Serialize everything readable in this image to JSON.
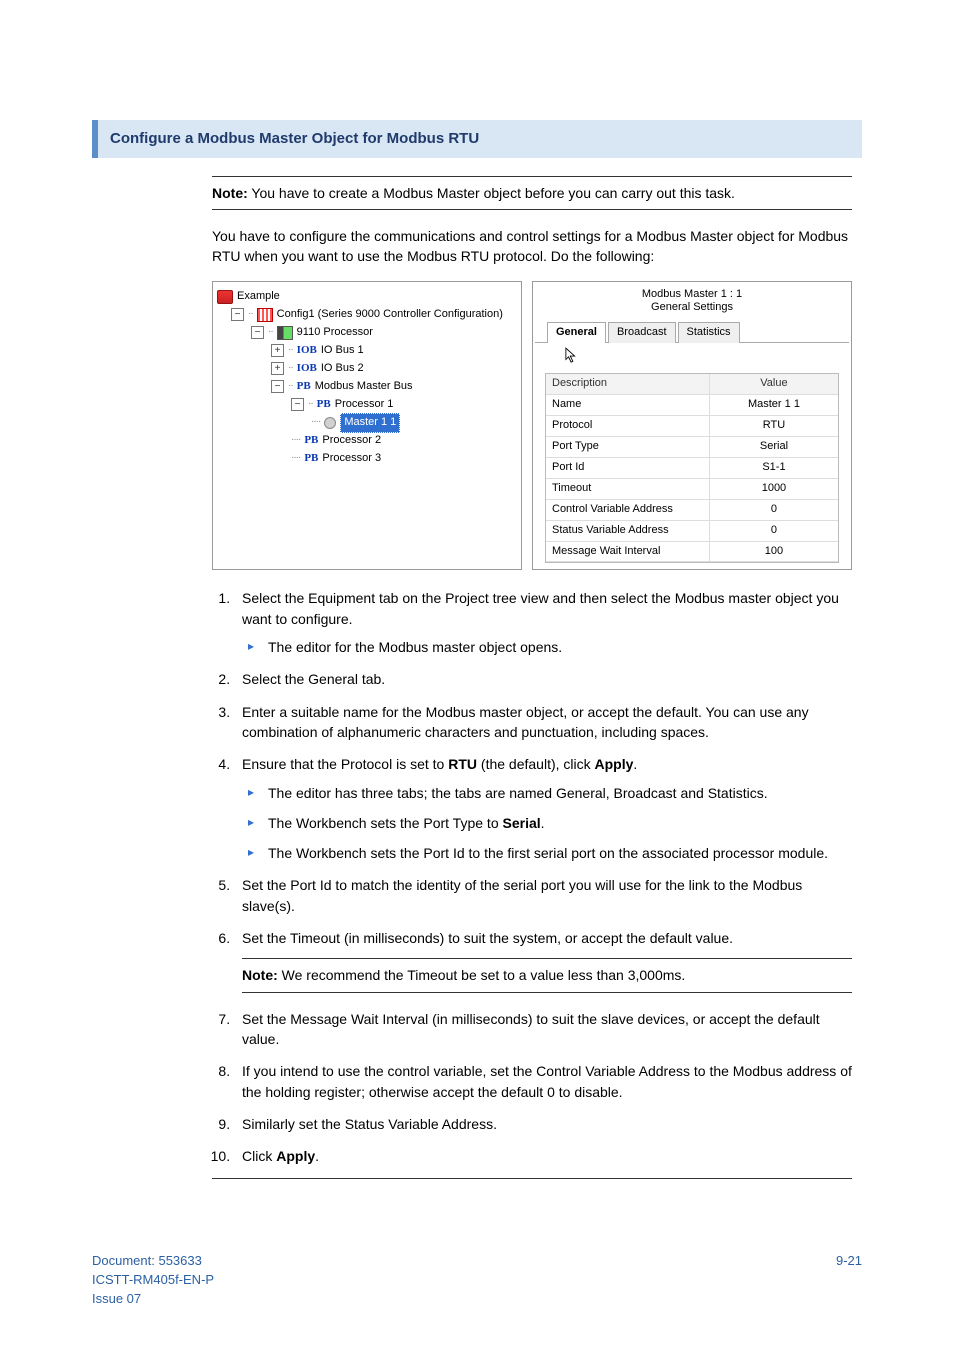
{
  "section_title": "Configure a Modbus Master Object for Modbus RTU",
  "note_label": "Note:",
  "top_note": " You have to create a Modbus Master object before you can carry out this task.",
  "intro": "You have to configure the communications and control settings for a Modbus Master object for Modbus RTU when you want to use the Modbus RTU protocol. Do the following:",
  "tree": {
    "root": "Example",
    "config": "Config1 (Series 9000 Controller Configuration)",
    "processor": "9110 Processor",
    "iob_label": "IOB",
    "iob1": "IO Bus 1",
    "iob2": "IO Bus 2",
    "pb_label": "PB",
    "mmb": "Modbus Master Bus",
    "proc1": "Processor 1",
    "master11": "Master 1 1",
    "proc2": "Processor 2",
    "proc3": "Processor 3"
  },
  "prop": {
    "title_line1": "Modbus Master 1 : 1",
    "title_line2": "General Settings",
    "tabs": {
      "general": "General",
      "broadcast": "Broadcast",
      "statistics": "Statistics"
    },
    "head_desc": "Description",
    "head_val": "Value",
    "rows": {
      "name_k": "Name",
      "name_v": "Master 1 1",
      "proto_k": "Protocol",
      "proto_v": "RTU",
      "ptype_k": "Port Type",
      "ptype_v": "Serial",
      "pid_k": "Port Id",
      "pid_v": "S1-1",
      "to_k": "Timeout",
      "to_v": "1000",
      "cva_k": "Control Variable Address",
      "cva_v": "0",
      "sva_k": "Status Variable Address",
      "sva_v": "0",
      "mwi_k": "Message Wait Interval",
      "mwi_v": "100"
    }
  },
  "steps": {
    "s1": "Select the Equipment tab on the Project tree view and then select the Modbus master object you want to configure.",
    "s1a": "The editor for the Modbus master object opens.",
    "s2": "Select the General tab.",
    "s3": "Enter a suitable name for the Modbus master object, or accept the default. You can use any combination of alphanumeric characters and punctuation, including spaces.",
    "s4_a": "Ensure that the Protocol is set to ",
    "s4_b": "RTU",
    "s4_c": " (the default), click ",
    "s4_d": "Apply",
    "s4_e": ".",
    "s4sub1": "The editor has three tabs; the tabs are named General, Broadcast and Statistics.",
    "s4sub2_a": "The Workbench sets the Port Type to ",
    "s4sub2_b": "Serial",
    "s4sub2_c": ".",
    "s4sub3": "The Workbench sets the Port Id to the first serial port on the associated processor module.",
    "s5": "Set the Port Id to match the identity of the serial port you will use for the link to the Modbus slave(s).",
    "s6": "Set the Timeout (in milliseconds) to suit the system, or accept the default value.",
    "s6note": " We recommend the Timeout be set to a value less than 3,000ms.",
    "s7": "Set the Message Wait Interval (in milliseconds) to suit the slave devices, or accept the default value.",
    "s8": "If you intend to use the control variable, set the Control Variable Address to the Modbus address of the holding register; otherwise accept the default 0 to disable.",
    "s9": "Similarly set the Status Variable Address.",
    "s10_a": "Click ",
    "s10_b": "Apply",
    "s10_c": "."
  },
  "footer": {
    "doc": "Document: 553633",
    "part": "ICSTT-RM405f-EN-P",
    "issue": " Issue 07",
    "page": "9-21"
  }
}
